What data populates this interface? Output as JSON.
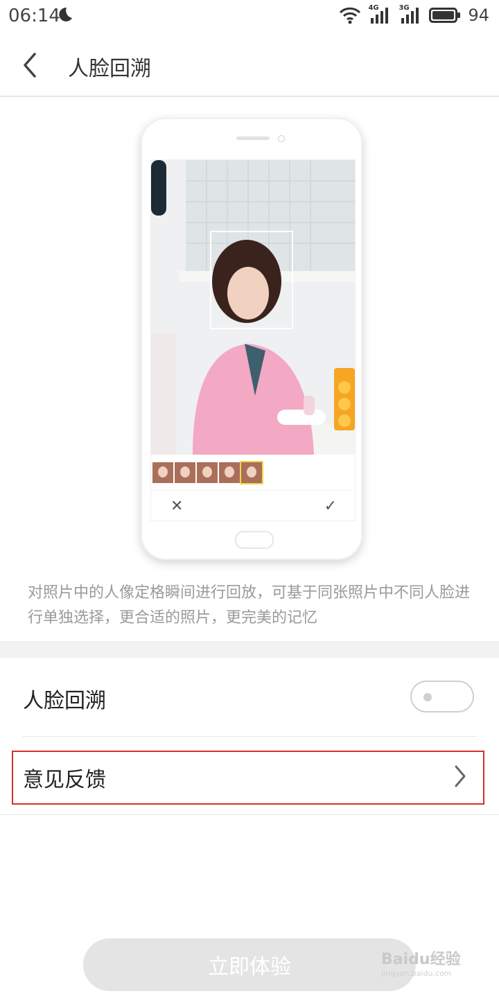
{
  "status_bar": {
    "time": "06:14",
    "network_1": "4G",
    "network_2": "3G",
    "battery": "94"
  },
  "header": {
    "title": "人脸回溯"
  },
  "description": "对照片中的人像定格瞬间进行回放，可基于同张照片中不同人脸进行单独选择，更合适的照片，更完美的记忆",
  "settings": {
    "face_rewind_label": "人脸回溯",
    "face_rewind_enabled": false,
    "feedback_label": "意见反馈"
  },
  "cta_label": "立即体验",
  "watermark": {
    "brand": "Baidu经验",
    "url": "jingyan.baidu.com"
  },
  "colors": {
    "highlight": "#d0312d",
    "cta_disabled": "#e4e4e4",
    "desc_text": "#9a9a9a"
  }
}
